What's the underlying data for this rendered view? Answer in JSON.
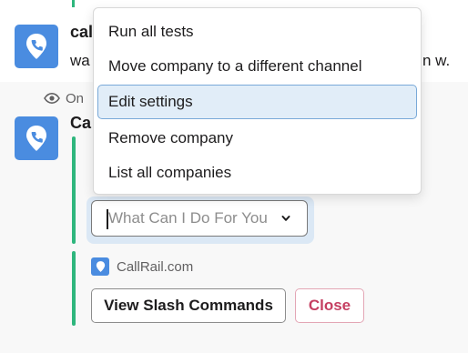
{
  "top_message": {
    "name": "cal",
    "text": "wa",
    "text_tail": "n w."
  },
  "ephemeral": {
    "label": "On",
    "name": "Ca"
  },
  "select": {
    "placeholder": "What Can I Do For You"
  },
  "brand": {
    "name": "CallRail.com"
  },
  "buttons": {
    "view_label": "View Slash Commands",
    "close_label": "Close"
  },
  "menu": {
    "items": [
      {
        "label": "Run all tests"
      },
      {
        "label": "Move company to a different channel"
      },
      {
        "label": "Edit settings",
        "active": true
      },
      {
        "label": "Remove company"
      },
      {
        "label": "List all companies"
      }
    ]
  },
  "colors": {
    "brand": "#4a8ce0",
    "accent_bar": "#2eb67d",
    "danger": "#c53f61",
    "highlight": "#e1edf8"
  }
}
